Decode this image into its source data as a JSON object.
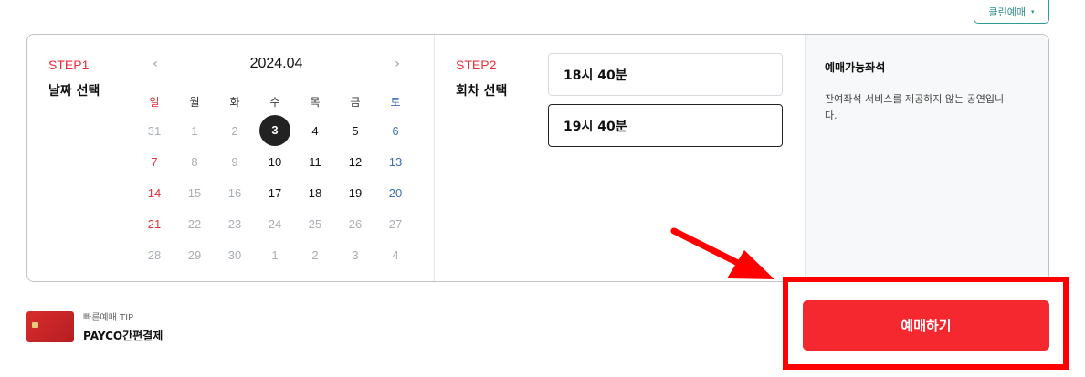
{
  "header": {
    "clean_booking_label": "클린예매",
    "caret": "▾"
  },
  "date_step": {
    "step_label": "STEP1",
    "title": "날짜 선택",
    "prev_icon": "‹",
    "next_icon": "›",
    "month_label": "2024.04",
    "weekdays": [
      "일",
      "월",
      "화",
      "수",
      "목",
      "금",
      "토"
    ],
    "weeks": [
      [
        "31",
        "1",
        "2",
        "3",
        "4",
        "5",
        "6"
      ],
      [
        "7",
        "8",
        "9",
        "10",
        "11",
        "12",
        "13"
      ],
      [
        "14",
        "15",
        "16",
        "17",
        "18",
        "19",
        "20"
      ],
      [
        "21",
        "22",
        "23",
        "24",
        "25",
        "26",
        "27"
      ],
      [
        "28",
        "29",
        "30",
        "1",
        "2",
        "3",
        "4"
      ]
    ],
    "selected_date": "3"
  },
  "time_step": {
    "step_label": "STEP2",
    "title": "회차 선택",
    "times": [
      {
        "label": "18시 40분",
        "selected": false
      },
      {
        "label": "19시 40분",
        "selected": true
      }
    ]
  },
  "seat_info": {
    "title": "예매가능좌석",
    "description": "잔여좌석 서비스를 제공하지 않는 공연입니다."
  },
  "tip": {
    "small": "빠른예매 TIP",
    "big": "PAYCO간편결제"
  },
  "book_button": {
    "label": "예매하기"
  },
  "colors": {
    "accent_red": "#f5282f",
    "teal": "#2f9c9a",
    "sunday": "#e8303a",
    "saturday": "#3d6fb0",
    "annotation_red": "#ff0000"
  },
  "icons": {
    "prev": "chevron-left-icon",
    "next": "chevron-right-icon",
    "card": "payco-card-icon",
    "annotation": "red-arrow-icon"
  }
}
